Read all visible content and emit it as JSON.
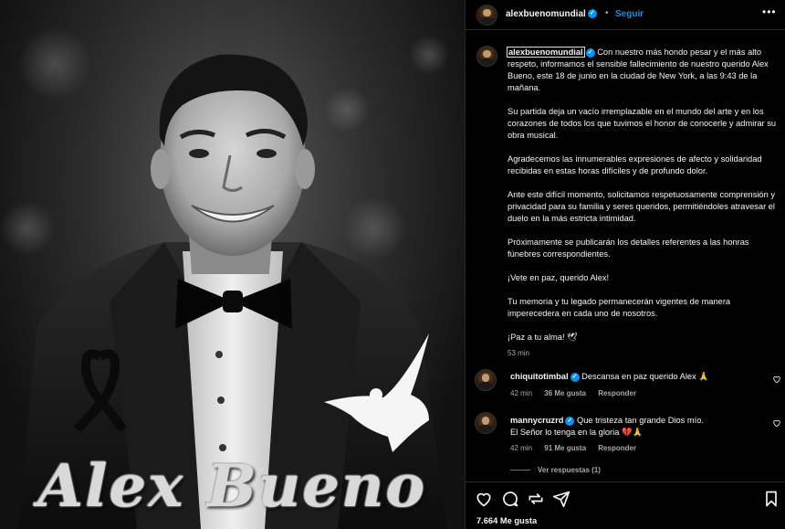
{
  "photo": {
    "overlay_name": "Alex Bueno"
  },
  "header": {
    "username": "alexbuenomundial",
    "verified": "✓",
    "separator": "•",
    "follow_label": "Seguir",
    "more_label": "•••"
  },
  "caption": {
    "username": "alexbuenomundial",
    "paragraphs": [
      "Con nuestro más hondo pesar y el más alto respeto, informamos el sensible fallecimiento de nuestro querido Alex Bueno, este 18 de junio en la ciudad de New York, a las 9:43 de la mañana.",
      "Su partida deja un vacío irremplazable en el mundo del arte y en los corazones de todos los que tuvimos el honor de conocerle y admirar su obra musical.",
      "Agradecemos las innumerables expresiones de afecto y solidaridad recibidas en estas horas difíciles y de profundo dolor.",
      "Ante este difícil momento, solicitamos respetuosamente comprensión y privacidad para su familia y seres queridos, permitiéndoles atravesar el duelo en la más estricta intimidad.",
      "Próximamente se publicarán los detalles referentes a las honras fúnebres correspondientes.",
      "¡Vete en paz, querido Alex!",
      "Tu memoria y tu legado permanecerán vigentes de manera imperecedera en cada uno de nosotros.",
      "¡Paz a tu alma! 🕊"
    ],
    "time": "53 min"
  },
  "comments": [
    {
      "username": "chiquitotimbal",
      "text": "Descansa en paz querido Alex 🙏",
      "time": "42 min",
      "likes": "36 Me gusta",
      "reply_label": "Responder"
    },
    {
      "username": "mannycruzrd",
      "text": "Que tristeza tan grande Dios mío.",
      "text2": "El Señor lo tenga en la gloria 💔🙏",
      "time": "42 min",
      "likes": "91 Me gusta",
      "reply_label": "Responder",
      "view_replies": "Ver respuestas (1)"
    }
  ],
  "footer": {
    "likes_count": "7.664 Me gusta"
  },
  "colors": {
    "accent": "#0095f6",
    "muted": "#a8a8a8",
    "heart_red": "#ed4956"
  }
}
